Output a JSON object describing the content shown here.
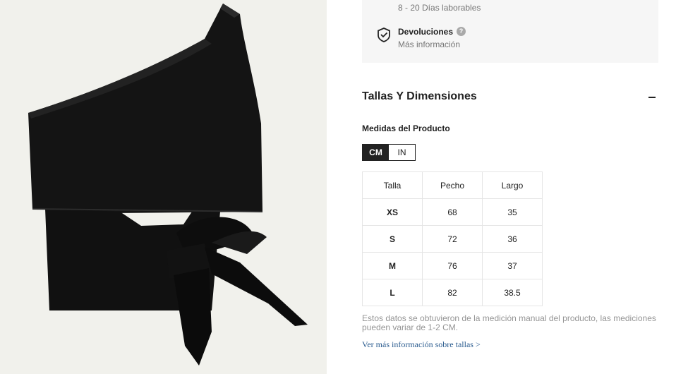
{
  "shipping": {
    "days": "8 - 20 Días laborables",
    "returns_title": "Devoluciones",
    "returns_help": "?",
    "returns_more": "Más información"
  },
  "sizes_section": {
    "title": "Tallas Y Dimensiones",
    "measure_label": "Medidas del Producto",
    "units": [
      {
        "label": "CM",
        "active": true
      },
      {
        "label": "IN",
        "active": false
      }
    ],
    "table": {
      "headers": [
        "Talla",
        "Pecho",
        "Largo"
      ],
      "rows": [
        [
          "XS",
          "68",
          "35"
        ],
        [
          "S",
          "72",
          "36"
        ],
        [
          "M",
          "76",
          "37"
        ],
        [
          "L",
          "82",
          "38.5"
        ]
      ]
    },
    "disclaimer": "Estos datos se obtuvieron de la medición manual del producto, las mediciones pueden variar de 1-2 CM.",
    "more_link": "Ver más información sobre tallas >"
  },
  "colors": {
    "image_background": "#f1f1ec",
    "garment": "#141414",
    "info_box": "#f6f6f6",
    "link": "#2b5c8f"
  }
}
